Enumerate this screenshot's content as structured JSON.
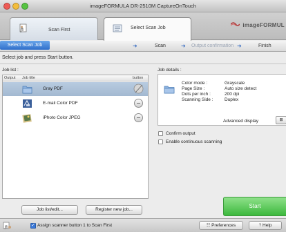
{
  "window": {
    "title": "imageFORMULA DR-2510M CaptureOnTouch",
    "traffic_light_colors": [
      "#ee5b55",
      "#f3bd3b",
      "#56c342"
    ]
  },
  "mode_tabs": [
    {
      "label": "Scan First",
      "icon": "scan-first-icon"
    },
    {
      "label": "Select Scan Job",
      "icon": "select-scan-job-icon"
    }
  ],
  "brand": {
    "logo_text": "imageFORMUL"
  },
  "steps": [
    {
      "label": "Select Scan Job",
      "active": true
    },
    {
      "label": "Scan",
      "active": false
    },
    {
      "label": "Output confirmation",
      "active": false
    },
    {
      "label": "Finish",
      "active": false
    }
  ],
  "instruction": "Select job and press Start button.",
  "job_list": {
    "label": "Job list :",
    "columns": [
      "Output",
      "Job title",
      "button"
    ],
    "rows": [
      {
        "title": "Gray PDF",
        "icon": "folder-icon",
        "selected": true
      },
      {
        "title": "E-mail Color PDF",
        "icon": "email-icon",
        "selected": false
      },
      {
        "title": "iPhoto Color JPEG",
        "icon": "iphoto-icon",
        "selected": false
      }
    ],
    "buttons": {
      "edit": "Job list/edit...",
      "register": "Register new job..."
    }
  },
  "job_details": {
    "label": "Job details :",
    "rows": [
      {
        "key": "Color mode :",
        "value": "Grayscale"
      },
      {
        "key": "Page Size :",
        "value": "Auto size detect"
      },
      {
        "key": "Dots per inch :",
        "value": "200 dpi"
      },
      {
        "key": "Scanning Side :",
        "value": "Duplex"
      }
    ],
    "advanced_label": "Advanced display",
    "advanced_button": "⊞"
  },
  "options": {
    "confirm_output": {
      "label": "Confirm output",
      "checked": false
    },
    "continuous_scanning": {
      "label": "Enable continuous scanning",
      "checked": false
    }
  },
  "start_button": "Start",
  "bottom": {
    "assign_label": "Assign scanner button 1 to Scan First",
    "assign_checked": true,
    "preferences": "Preferences",
    "preferences_icon": "preferences-icon",
    "help": "Help",
    "help_icon": "question-icon"
  },
  "colors": {
    "accent_blue": "#2f6fcb",
    "selected_row": "#a3b9d1",
    "start_green": "#3cb83c"
  }
}
